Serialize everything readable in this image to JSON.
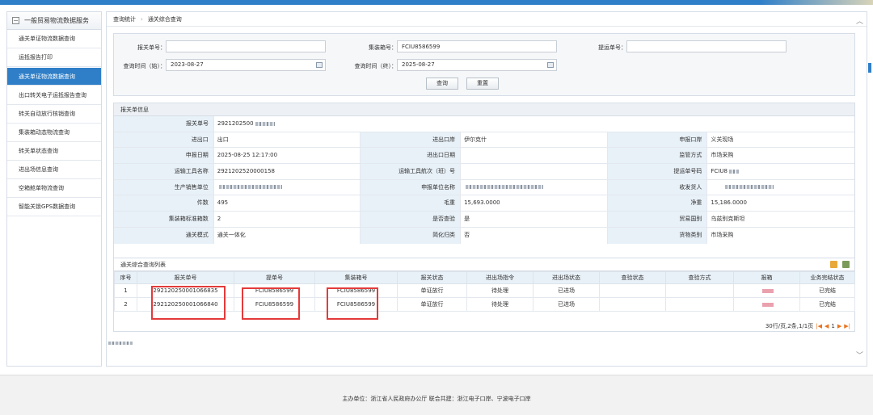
{
  "sidebar": {
    "title": "一般贸易物流数据服务",
    "items": [
      {
        "label": "通关单证物流数据查询"
      },
      {
        "label": "运抵报告打印"
      },
      {
        "label": "通关单证物流数据查询"
      },
      {
        "label": "出口转关电子运抵报告查询"
      },
      {
        "label": "转关自动放行核销查询"
      },
      {
        "label": "集装箱动态物流查询"
      },
      {
        "label": "转关单状态查询"
      },
      {
        "label": "进出场信息查询"
      },
      {
        "label": "空箱舱单物流查询"
      },
      {
        "label": "智能关锁GPS数据查询"
      }
    ]
  },
  "breadcrumb": {
    "level1": "查询统计",
    "level2": "通关综合查询"
  },
  "search": {
    "declaration_label": "报关单号：",
    "declaration_value": "",
    "container_label": "集装箱号：",
    "container_value": "FCIU8586599",
    "bill_label": "提运单号：",
    "bill_value": "",
    "start_label": "查询时间（始）：",
    "start_value": "2023-08-27",
    "end_label": "查询时间（终）：",
    "end_value": "2025-08-27",
    "query_button": "查询",
    "reset_button": "重置"
  },
  "info": {
    "title": "报关单信息",
    "declaration_no_label": "报关单号",
    "declaration_no_value": "2921202500",
    "ie_label": "进出口",
    "ie_value": "出口",
    "ie_port_label": "进出口岸",
    "ie_port_value": "伊尔克什",
    "decl_port_label": "申报口岸",
    "decl_port_value": "义关现场",
    "decl_date_label": "申报日期",
    "decl_date_value": "2025-08-25 12:17:00",
    "ie_date_label": "进出口日期",
    "ie_date_value": "",
    "supervise_label": "监管方式",
    "supervise_value": "市场采购",
    "transport_label": "运输工具名称",
    "transport_value": "2921202520000158",
    "voyage_label": "运输工具航次（班）号",
    "voyage_value": "",
    "bill_label": "提运单号码",
    "bill_value": "FCIU8",
    "producer_label": "生产销售单位",
    "declarer_label": "申报单位名称",
    "consignee_label": "收发货人",
    "pieces_label": "件数",
    "pieces_value": "495",
    "gross_label": "毛重",
    "gross_value": "15,693.0000",
    "net_label": "净重",
    "net_value": "15,186.0000",
    "container_count_label": "集装箱标准箱数",
    "container_count_value": "2",
    "checked_label": "是否查验",
    "checked_value": "是",
    "country_label": "贸易国别",
    "country_value": "乌兹别克斯坦",
    "mode_label": "通关模式",
    "mode_value": "通关一体化",
    "simplified_label": "简化归类",
    "simplified_value": "否",
    "goods_label": "货物类别",
    "goods_value": "市场采购"
  },
  "list": {
    "title": "通关综合查询列表",
    "columns": [
      "序号",
      "报关单号",
      "提单号",
      "集装箱号",
      "报关状态",
      "进出场指令",
      "进出场状态",
      "查验状态",
      "查验方式",
      "报箱",
      "业务完结状态"
    ],
    "rows": [
      {
        "no": "1",
        "decl": "292120250001066835",
        "bill": "FCIU8586599",
        "container": "FCIU8586599",
        "status": "单证放行",
        "instruction": "待处理",
        "field_status": "已进场",
        "inspect_status": "",
        "inspect_mode": "",
        "box": "",
        "done": "已完结"
      },
      {
        "no": "2",
        "decl": "292120250001066840",
        "bill": "FCIU8586599",
        "container": "FCIU8586599",
        "status": "单证放行",
        "instruction": "待处理",
        "field_status": "已进场",
        "inspect_status": "",
        "inspect_mode": "",
        "box": "",
        "done": "已完结"
      }
    ],
    "pager_text": "30行/页,2条,1/1页",
    "page_number": "1"
  },
  "footer": {
    "text": "主办单位：浙江省人民政府办公厅   联合共建：浙江电子口岸、宁波电子口岸"
  },
  "colors": {
    "accent": "#2f7fc8",
    "highlight": "#e43a3a"
  }
}
